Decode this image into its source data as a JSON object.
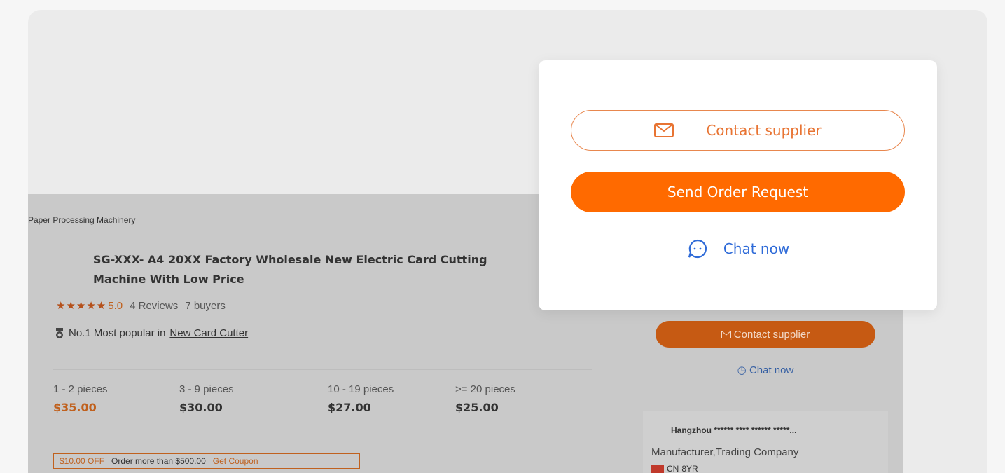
{
  "breadcrumb": {
    "category": "Paper Processing Machinery"
  },
  "product": {
    "title": "SG-XXX- A4 20XX Factory Wholesale New Electric Card Cutting Machine With Low Price",
    "stars": "★★★★★",
    "rating": "5.0",
    "reviews": "4 Reviews",
    "buyers": "7 buyers",
    "popular_prefix": "No.1 Most popular in",
    "popular_link": "New Card Cutter"
  },
  "price_tiers": [
    {
      "qty": "1 - 2 pieces",
      "price": "$35.00"
    },
    {
      "qty": "3 - 9 pieces",
      "price": "$30.00"
    },
    {
      "qty": "10 - 19 pieces",
      "price": "$27.00"
    },
    {
      "qty": ">= 20 pieces",
      "price": "$25.00"
    }
  ],
  "coupon": {
    "off": "$10.00 OFF",
    "condition": "Order more than $500.00",
    "link": "Get Coupon"
  },
  "sidebar": {
    "contact_label": "Contact supplier",
    "chat_label": "Chat now"
  },
  "supplier": {
    "name": "Hangzhou ****** **** ****** *****...",
    "type": "Manufacturer,Trading Company",
    "country": "CN",
    "years": "8YR"
  },
  "popup": {
    "contact_label": "Contact supplier",
    "order_label": "Send Order Request",
    "chat_label": "Chat now"
  },
  "colors": {
    "accent": "#ff6a00",
    "link_blue": "#2f6bd8"
  }
}
